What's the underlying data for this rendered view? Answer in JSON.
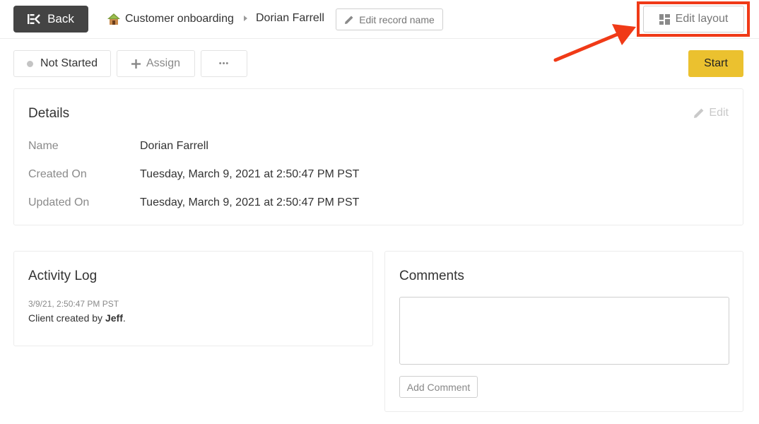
{
  "topbar": {
    "back_label": "Back",
    "app_name": "Customer onboarding",
    "record_name": "Dorian Farrell",
    "edit_record_name_label": "Edit record name",
    "edit_layout_label": "Edit layout"
  },
  "actions": {
    "status_label": "Not Started",
    "assign_label": "Assign",
    "more_label": "•••",
    "start_label": "Start"
  },
  "details": {
    "title": "Details",
    "edit_label": "Edit",
    "fields": [
      {
        "label": "Name",
        "value": "Dorian Farrell"
      },
      {
        "label": "Created On",
        "value": "Tuesday, March 9, 2021 at 2:50:47 PM PST"
      },
      {
        "label": "Updated On",
        "value": "Tuesday, March 9, 2021 at 2:50:47 PM PST"
      }
    ]
  },
  "activity": {
    "title": "Activity Log",
    "entries": [
      {
        "time": "3/9/21, 2:50:47 PM PST",
        "text_prefix": "Client created by ",
        "actor": "Jeff",
        "text_suffix": "."
      }
    ]
  },
  "comments": {
    "title": "Comments",
    "input_value": "",
    "add_label": "Add Comment"
  },
  "colors": {
    "accent_start": "#ebc12f",
    "highlight": "#f03a17",
    "back_bg": "#444444"
  }
}
